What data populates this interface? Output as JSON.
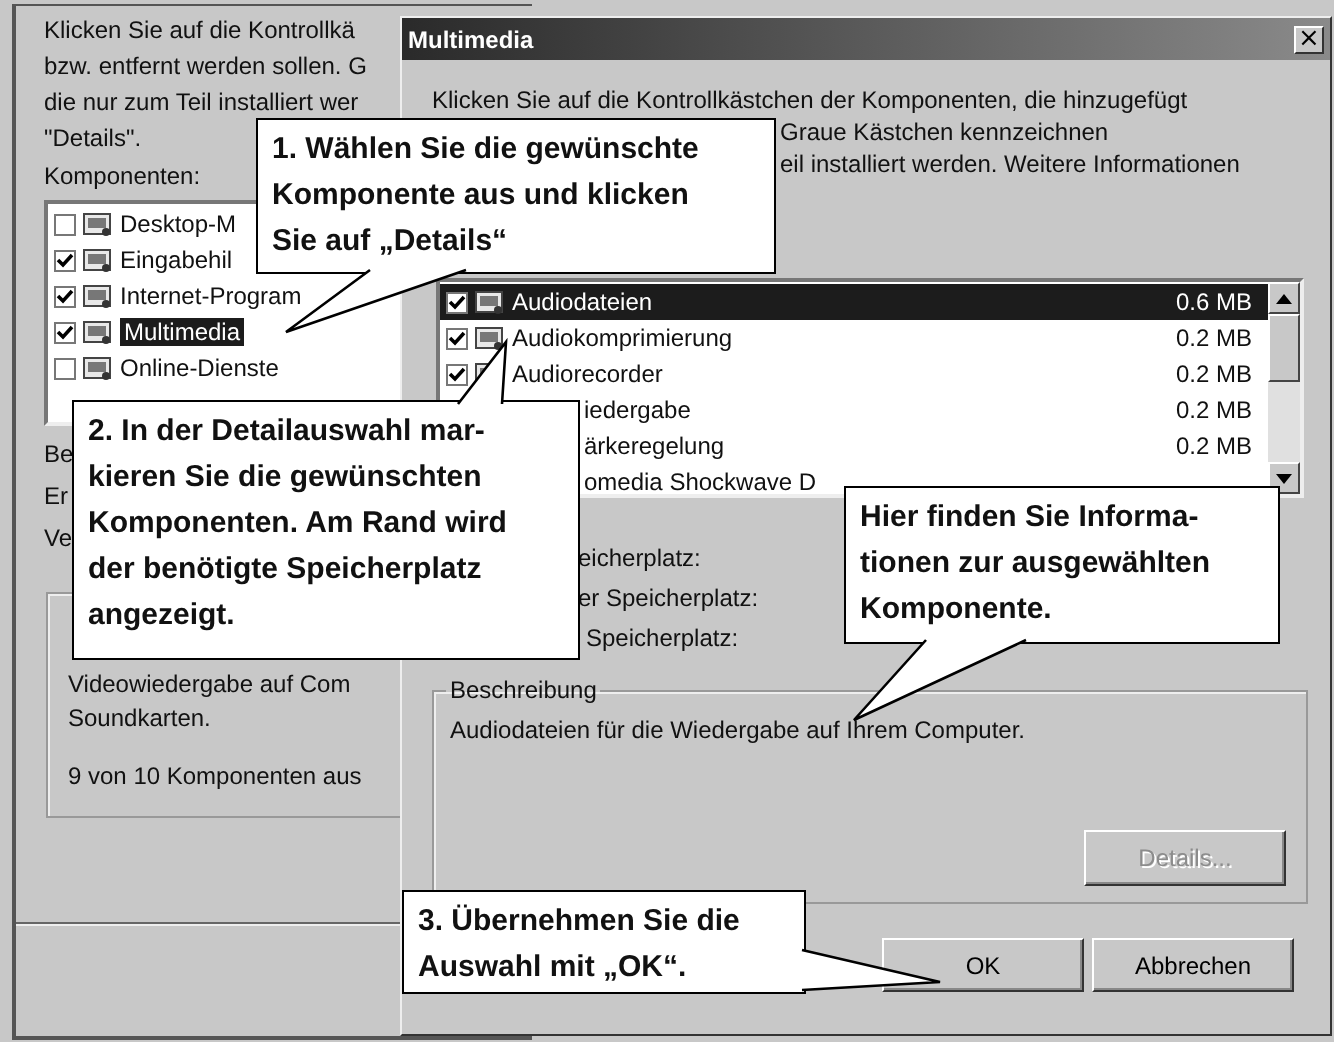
{
  "back_window": {
    "intro_lines": [
      "Klicken Sie auf die Kontrollkä",
      "bzw. entfernt werden sollen. G",
      "die nur zum Teil installiert wer",
      "\"Details\"."
    ],
    "list_label": "Komponenten:",
    "components": [
      {
        "label": "Desktop-M",
        "checked": false,
        "selected": false
      },
      {
        "label": "Eingabehil",
        "checked": true,
        "selected": false
      },
      {
        "label": "Internet-Program",
        "checked": true,
        "selected": false
      },
      {
        "label": "Multimedia",
        "checked": true,
        "selected": true
      },
      {
        "label": "Online-Dienste",
        "checked": false,
        "selected": false
      }
    ],
    "side_labels": [
      "Be",
      "Er",
      "Ve"
    ],
    "group_lines": [
      "Videowiedergabe auf Com",
      "Soundkarten.",
      "9 von 10 Komponenten aus"
    ]
  },
  "dialog": {
    "title": "Multimedia",
    "close": "×",
    "intro_lines": [
      {
        "kind": "full",
        "text": "Klicken Sie auf die Kontrollkästchen der Komponenten, die hinzugefügt"
      },
      {
        "kind": "covered",
        "text": "Graue Kästchen kennzeichnen"
      },
      {
        "kind": "covered",
        "text": "eil installiert werden. Weitere Informationen"
      }
    ],
    "components": [
      {
        "kind": "full",
        "label": "Audiodateien",
        "size": "0.6 MB",
        "checked": true,
        "selected": true
      },
      {
        "kind": "full",
        "label": "Audiokomprimierung",
        "size": "0.2 MB",
        "checked": true,
        "selected": false
      },
      {
        "kind": "full",
        "label": "Audiorecorder",
        "size": "0.2 MB",
        "checked": true,
        "selected": false
      },
      {
        "kind": "covered",
        "label": "iedergabe",
        "size": "0.2 MB",
        "selected": false
      },
      {
        "kind": "covered",
        "label": "ärkeregelung",
        "size": "0.2 MB",
        "selected": false
      },
      {
        "kind": "covered",
        "label": "omedia Shockwave D",
        "selected": false
      }
    ],
    "storage_lines": [
      "eicherplatz:",
      "er Speicherplatz:",
      "Speicherplatz:"
    ],
    "description": {
      "legend": "Beschreibung",
      "text": "Audiodateien für die Wiedergabe auf Ihrem Computer.",
      "details_button": {
        "label": "Details...",
        "disabled": true
      }
    },
    "buttons": [
      {
        "label": "OK"
      },
      {
        "label": "Abbrechen"
      }
    ]
  },
  "callouts": [
    {
      "text": "1. Wählen Sie die gewünschte\nKomponente aus und klicken\nSie auf „Details“"
    },
    {
      "text": "2. In der Detailauswahl mar-\nkieren Sie die gewünschten\nKomponenten. Am Rand wird\nder benötigte Speicherplatz\nangezeigt."
    },
    {
      "text": "Hier finden Sie Informa-\ntionen zur ausgewählten\nKomponente."
    },
    {
      "text": "3. Übernehmen Sie die\nAuswahl mit „OK“."
    }
  ]
}
